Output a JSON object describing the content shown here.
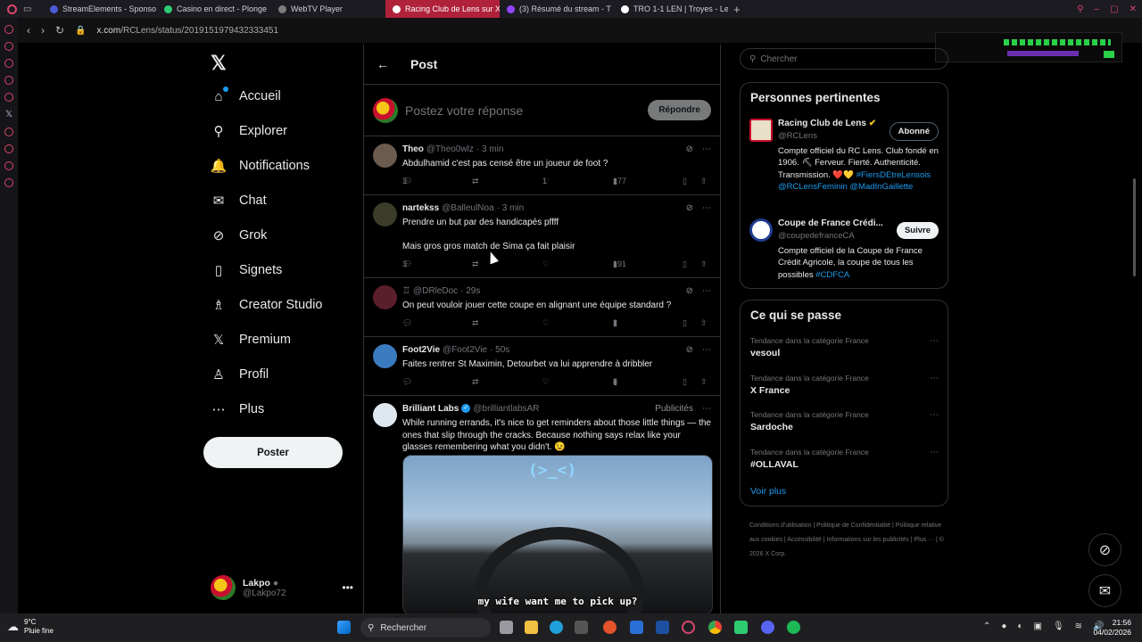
{
  "browser": {
    "tabs": [
      {
        "title": "StreamElements - Sponso",
        "color": "#4c5bd4",
        "active": false
      },
      {
        "title": "Casino en direct - Plonge",
        "color": "#2ecc71",
        "active": false
      },
      {
        "title": "WebTV Player",
        "color": "#7d7d7d",
        "active": false
      },
      {
        "title": "Racing Club de Lens sur X",
        "color": "#ffffff",
        "active": true
      },
      {
        "title": "(3) Résumé du stream - T",
        "color": "#9146ff",
        "active": false
      },
      {
        "title": "TRO 1-1 LEN | Troyes - Le",
        "color": "#ffffff",
        "active": false
      }
    ],
    "url_host": "x.com",
    "url_path": "/RCLens/status/2019151979432333451"
  },
  "nav": {
    "items": [
      {
        "label": "Accueil",
        "icon": "⌂"
      },
      {
        "label": "Explorer",
        "icon": "⚲"
      },
      {
        "label": "Notifications",
        "icon": "🔔"
      },
      {
        "label": "Chat",
        "icon": "✉"
      },
      {
        "label": "Grok",
        "icon": "⊘"
      },
      {
        "label": "Signets",
        "icon": "▯"
      },
      {
        "label": "Creator Studio",
        "icon": "♗"
      },
      {
        "label": "Premium",
        "icon": "𝕏"
      },
      {
        "label": "Profil",
        "icon": "♙"
      },
      {
        "label": "Plus",
        "icon": "⋯"
      }
    ],
    "post_button": "Poster",
    "account": {
      "name": "Lakpo",
      "handle": "@Lakpo72"
    }
  },
  "main": {
    "title": "Post",
    "reply_placeholder": "Postez votre réponse",
    "reply_button": "Répondre",
    "tweets": [
      {
        "name": "Theo",
        "handle": "@Theo0wlz",
        "time": "· 3 min",
        "text": "Abdulhamid c'est pas censé être un joueur de foot ?",
        "replies": "3",
        "likes": "1",
        "views": "177"
      },
      {
        "name": "nartekss",
        "handle": "@BalleulNoa",
        "time": "· 3 min",
        "text": "Prendre un but par des handicapés pffff",
        "text2": "Mais gros gros match de Sima ça fait plaisir",
        "replies": "3",
        "likes": "",
        "views": "191"
      },
      {
        "name": "",
        "handle": "@DRleDoc",
        "time": "· 29s",
        "text": "On peut vouloir jouer cette coupe en alignant une équipe standard ?",
        "replies": "",
        "likes": "",
        "views": "2"
      },
      {
        "name": "Foot2Vie",
        "handle": "@Foot2Vie",
        "time": "· 50s",
        "text": "Faites rentrer St Maximin, Detourbet va lui apprendre à dribbler",
        "replies": "",
        "likes": "",
        "views": "8"
      },
      {
        "name": "Brilliant Labs",
        "handle": "@brilliantlabsAR",
        "time": "",
        "promo": "Publicités",
        "text": "While running errands, it's nice to get reminders about those little things — the ones that slip through the cracks. Because nothing says relax like your glasses remembering what you didn't. 😉",
        "media_face": "(>_<)",
        "media_caption": "my wife want me to pick up?"
      }
    ]
  },
  "sidebar": {
    "search_placeholder": "Chercher",
    "people_title": "Personnes pertinentes",
    "people": [
      {
        "name": "Racing Club de Lens",
        "handle": "@RCLens",
        "follow": "Abonné",
        "bio": "Compte officiel du RC Lens. Club fondé en 1906. ⛏ Ferveur. Fierté. Authenticité. Transmission. ❤️💛",
        "tags": "#FiersDEtreLensois @RCLensFeminin @MadInGaillette"
      },
      {
        "name": "Coupe de France Crédi...",
        "handle": "@coupedefranceCA",
        "follow": "Suivre",
        "bio": "Compte officiel de la Coupe de France Crédit Agricole, la coupe de tous les possibles",
        "tags": "#CDFCA"
      }
    ],
    "trends_title": "Ce qui se passe",
    "trends": [
      {
        "category": "Tendance dans la catégorie France",
        "name": "vesoul"
      },
      {
        "category": "Tendance dans la catégorie France",
        "name": "X France"
      },
      {
        "category": "Tendance dans la catégorie France",
        "name": "Sardoche"
      },
      {
        "category": "Tendance dans la catégorie France",
        "name": "#OLLAVAL"
      }
    ],
    "more": "Voir plus",
    "footer": [
      "Conditions d'utilisation",
      "Politique de Confidentialité",
      "Politique relative aux cookies",
      "Accessibilité",
      "Informations sur les publicités",
      "Plus ···",
      "© 2026 X Corp."
    ]
  },
  "taskbar": {
    "temp": "9°C",
    "weather": "Pluie fine",
    "search": "Rechercher",
    "time": "21:56",
    "date": "04/02/2026"
  }
}
